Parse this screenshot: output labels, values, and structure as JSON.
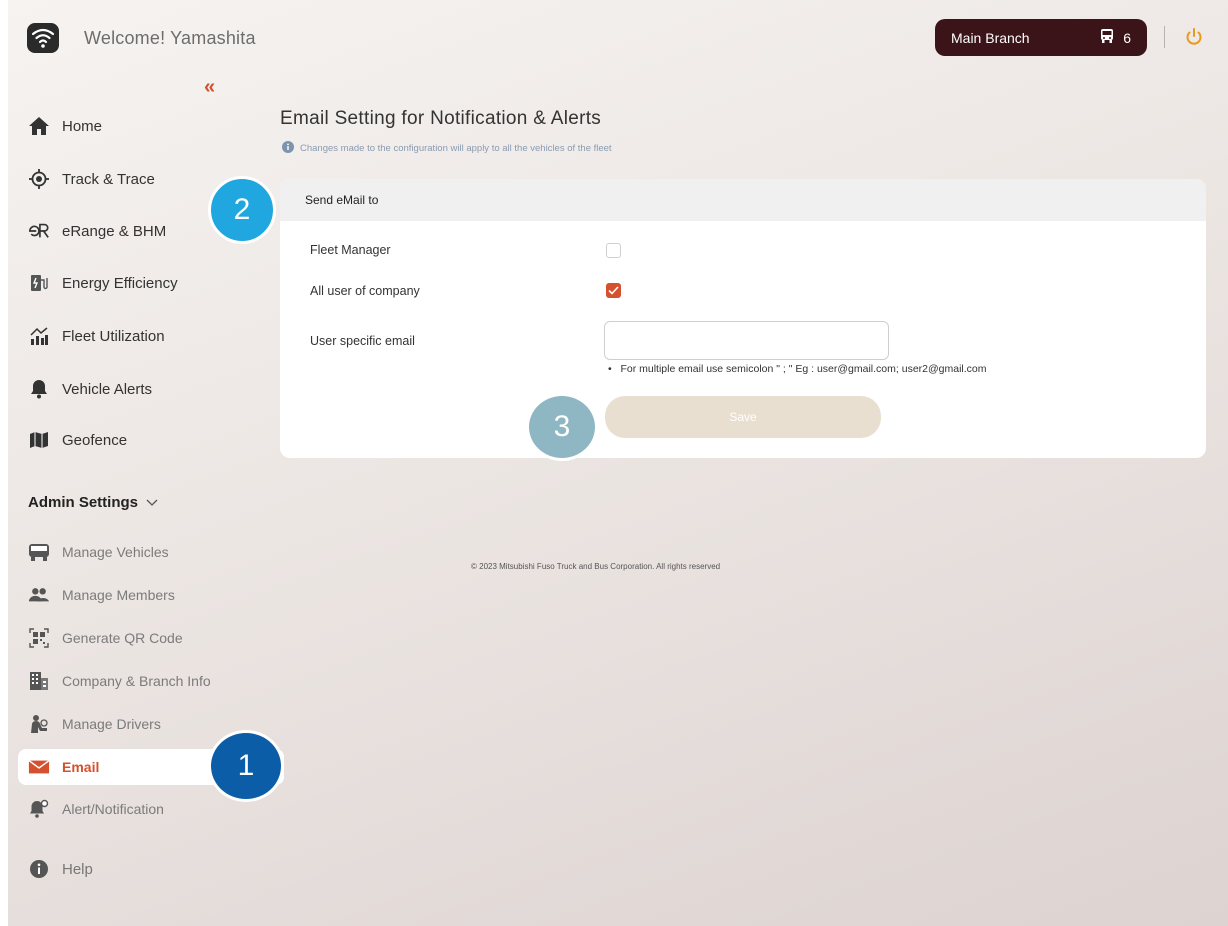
{
  "header": {
    "welcome_text": "Welcome! Yamashita",
    "branch_name": "Main Branch",
    "vehicle_count": "6",
    "collapse_glyph": "«"
  },
  "sidebar": {
    "items": [
      {
        "label": "Home",
        "icon": "home-icon"
      },
      {
        "label": "Track & Trace",
        "icon": "target-icon"
      },
      {
        "label": "eRange & BHM",
        "icon": "erange-icon"
      },
      {
        "label": "Energy Efficiency",
        "icon": "charging-station-icon"
      },
      {
        "label": "Fleet Utilization",
        "icon": "chart-icon"
      },
      {
        "label": "Vehicle Alerts",
        "icon": "bell-icon"
      },
      {
        "label": "Geofence",
        "icon": "map-icon"
      }
    ],
    "admin_heading": "Admin Settings",
    "admin_items": [
      {
        "label": "Manage Vehicles",
        "icon": "bus-icon"
      },
      {
        "label": "Manage Members",
        "icon": "users-icon"
      },
      {
        "label": "Generate QR Code",
        "icon": "qr-code-icon"
      },
      {
        "label": "Company & Branch Info",
        "icon": "building-icon"
      },
      {
        "label": "Manage Drivers",
        "icon": "driver-icon"
      },
      {
        "label": "Email",
        "icon": "envelope-icon"
      },
      {
        "label": "Alert/Notification",
        "icon": "bell-settings-icon"
      }
    ],
    "help_label": "Help"
  },
  "main": {
    "title": "Email Setting for Notification & Alerts",
    "info_note": "Changes made to the configuration will apply to all the vehicles of the fleet",
    "card": {
      "header": "Send eMail to",
      "fleet_manager_label": "Fleet Manager",
      "fleet_manager_checked": false,
      "all_users_label": "All user of company",
      "all_users_checked": true,
      "user_email_label": "User specific email",
      "user_email_value": "",
      "hint": "For multiple email use semicolon \" ; \" Eg : user@gmail.com; user2@gmail.com",
      "save_label": "Save"
    }
  },
  "badges": {
    "one": "1",
    "two": "2",
    "three": "3"
  },
  "footer": {
    "copyright": "© 2023 Mitsubishi Fuso Truck and Bus Corporation. All rights reserved"
  },
  "colors": {
    "accent": "#d4502e",
    "branch_bg": "#3a1418",
    "badge_dark": "#0b5da8",
    "badge_light": "#21a7e0",
    "badge_muted": "#8fb7c3"
  }
}
